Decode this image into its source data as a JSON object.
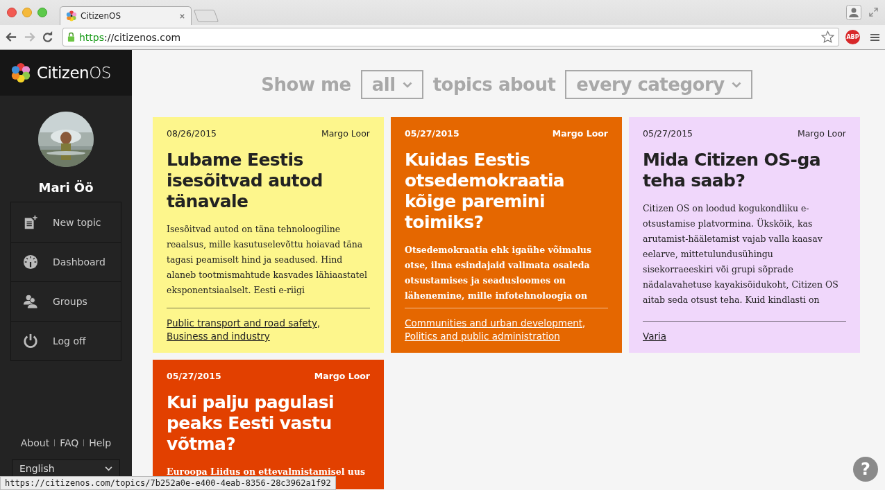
{
  "browser": {
    "tab_title": "CitizenOS",
    "url_scheme": "https",
    "url_rest": "://citizenos.com",
    "adblock_label": "ABP"
  },
  "sidebar": {
    "brand": "**Citizen**OS",
    "user_name": "Mari Öö",
    "menu": [
      {
        "label": "New topic",
        "kind": "new"
      },
      {
        "label": "Dashboard",
        "kind": "dashboard"
      },
      {
        "label": "Groups",
        "kind": "groups"
      },
      {
        "label": "Log off",
        "kind": "logoff"
      }
    ],
    "footer_links": [
      "About",
      "FAQ",
      "Help"
    ],
    "language": "English"
  },
  "filter": [
    {
      "kind": "text",
      "text": "Show me"
    },
    {
      "kind": "select",
      "text": "all"
    },
    {
      "kind": "text",
      "text": "topics about"
    },
    {
      "kind": "select",
      "text": "every category"
    }
  ],
  "topics": [
    {
      "date": "08/26/2015",
      "author": "Margo Loor",
      "title": "Lubame Eestis isesõitvad autod tänavale",
      "description": "Isesõitvad autod on täna tehnoloogiline reaalsus, mille kasutuselevõttu hoiavad täna tagasi peamiselt hind ja seadused. Hind alaneb tootmismahtude kasvades lähiaastatel eksponentsiaalselt. Eesti e-riigi",
      "categories": [
        {
          "label": "Public transport and road safety",
          "suffix": ","
        },
        {
          "label": "Business and industry"
        }
      ],
      "color": "#fdf68c"
    },
    {
      "date": "05/27/2015",
      "author": "Margo Loor",
      "title": "Kuidas Eestis otsedemokraatia kõige paremini toimiks?",
      "description": "Otsedemokraatia ehk igaühe võimalus otse, ilma esindajaid valimata osaleda otsustamises ja seadusloomes on lähenemine, mille infotehnoloogia on",
      "categories": [
        {
          "label": "Communities and urban development",
          "suffix": ","
        },
        {
          "label": "Politics and public administration"
        }
      ],
      "color": "#e56700"
    },
    {
      "date": "05/27/2015",
      "author": "Margo Loor",
      "title": "Mida Citizen OS-ga teha saab?",
      "description": "Citizen OS on loodud kogukondliku e-otsustamise platvormina. Ükskõik, kas arutamist-hääletamist vajab valla kaasav eelarve, mittetulundusühingu sisekorraeeskiri või grupi sõprade nädalavahetuse kayakisõidukoht, Citizen OS aitab seda otsust teha. Kuid kindlasti on",
      "categories": [
        {
          "label": "Varia"
        }
      ],
      "color": "#f0d7fb"
    },
    {
      "date": "05/27/2015",
      "author": "Margo Loor",
      "title": "Kui palju pagulasi peaks Eesti vastu võtma?",
      "description": "Euroopa Liidus on ettevalmistamisel uus",
      "color": "#e24000"
    }
  ],
  "status_bar": "https://citizenos.com/topics/7b252a0e-e400-4eab-8356-28c3962a1f92",
  "help_button": "?"
}
